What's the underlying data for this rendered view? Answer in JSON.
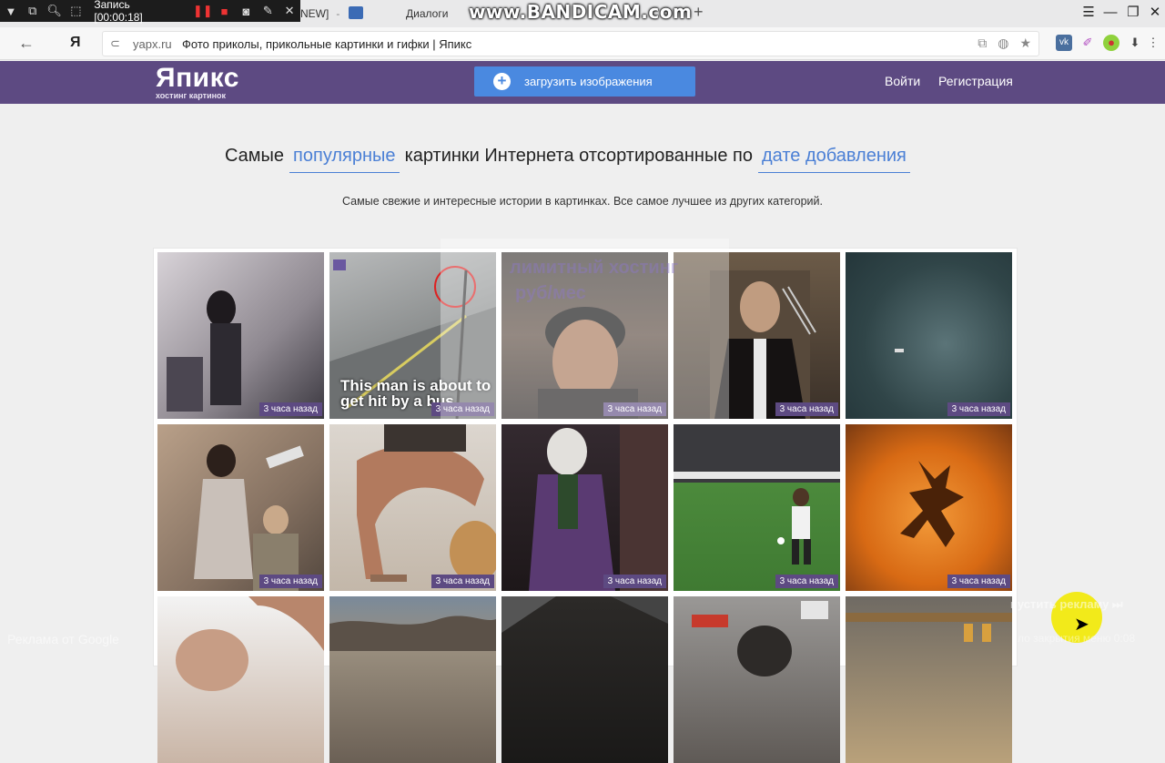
{
  "recorder": {
    "time": "Запись [00:00:18]",
    "watermark": "www.BANDICAM.com"
  },
  "browser": {
    "tabs": [
      "NEW]",
      "Диалоги"
    ],
    "domain": "yapx.ru",
    "page_title": "Фото приколы, прикольные картинки и гифки | Япикс",
    "yandex_logo": "Я",
    "new_tab": "+"
  },
  "header": {
    "logo": "Япикс",
    "logo_sub": "хостинг картинок",
    "upload_label": "загрузить изображения",
    "login": "Войти",
    "register": "Регистрация",
    "bg_color": "#5d4a82",
    "accent": "#4a89e0"
  },
  "headline": {
    "part1": "Самые",
    "filter1": "популярные",
    "part2": "картинки Интернета отсортированные по",
    "filter2": "дате добавления",
    "subtitle": "Самые свежие и интересные истории в картинках. Все самое лучшее из других категорий."
  },
  "grid": {
    "rows": [
      [
        {
          "name": "image-girl-mirror",
          "badge": "3 часа назад"
        },
        {
          "name": "image-street-cctv",
          "badge": "3 часа назад",
          "caption": "This man is about to get hit by a bus"
        },
        {
          "name": "image-man-beanie",
          "badge": "3 часа назад"
        },
        {
          "name": "image-wolverine-selfie",
          "badge": "3 часа назад"
        },
        {
          "name": "image-sea-boat",
          "badge": "3 часа назад"
        }
      ],
      [
        {
          "name": "image-woman-kids",
          "badge": "3 часа назад"
        },
        {
          "name": "image-yoga-cat",
          "badge": "3 часа назад"
        },
        {
          "name": "image-joker",
          "badge": "3 часа назад"
        },
        {
          "name": "image-football",
          "badge": "3 часа назад"
        },
        {
          "name": "image-pumpkin",
          "badge": "3 часа назад"
        }
      ],
      [
        {
          "name": "image-haircut"
        },
        {
          "name": "image-rocky-river"
        },
        {
          "name": "image-dark-fence"
        },
        {
          "name": "image-subway-man"
        },
        {
          "name": "image-shelf"
        }
      ]
    ]
  },
  "overlay": {
    "ghost_line1": "лимитный хостинг",
    "ghost_line2": "руб/мес",
    "ad_left": "Реклама от Google",
    "ad_right": "пустить рекламу ⏭",
    "ad_right2": "ло закрытия меню 0:08"
  }
}
